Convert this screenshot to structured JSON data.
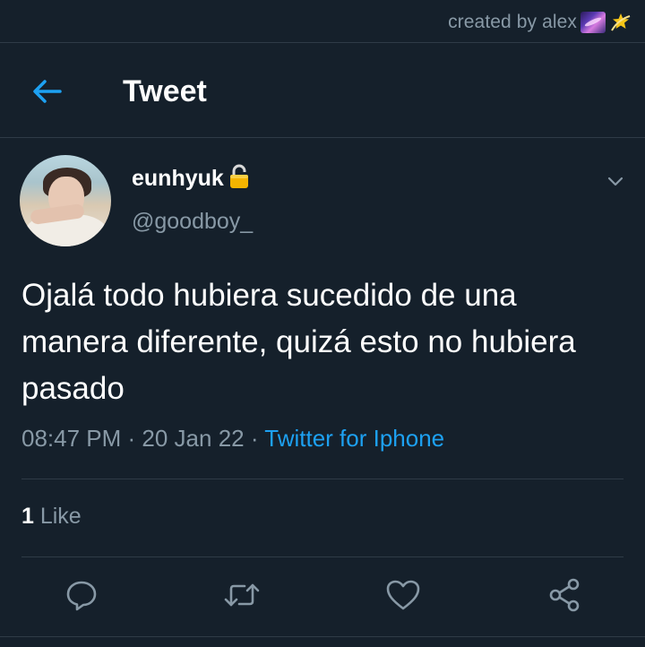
{
  "credit": {
    "text": "created by alex"
  },
  "header": {
    "title": "Tweet"
  },
  "author": {
    "name": "eunhyuk",
    "handle": "@goodboy_"
  },
  "tweet": {
    "text": "Ojalá todo hubiera sucedido de una manera diferente, quizá esto no hubiera pasado"
  },
  "meta": {
    "time": "08:47 PM",
    "sep1": " · ",
    "date": "20 Jan 22",
    "sep2": " · ",
    "source": "Twitter for Iphone"
  },
  "likes": {
    "count": "1",
    "label": " Like"
  },
  "colors": {
    "background": "#15202b",
    "accent": "#1da1f2",
    "secondary_text": "#8899a6",
    "divider": "#2f3b47"
  },
  "icons": [
    "galaxy-emoji",
    "dizzy-emoji",
    "back-arrow-icon",
    "lock-icon",
    "chevron-down-icon",
    "reply-icon",
    "retweet-icon",
    "like-icon",
    "share-icon"
  ]
}
